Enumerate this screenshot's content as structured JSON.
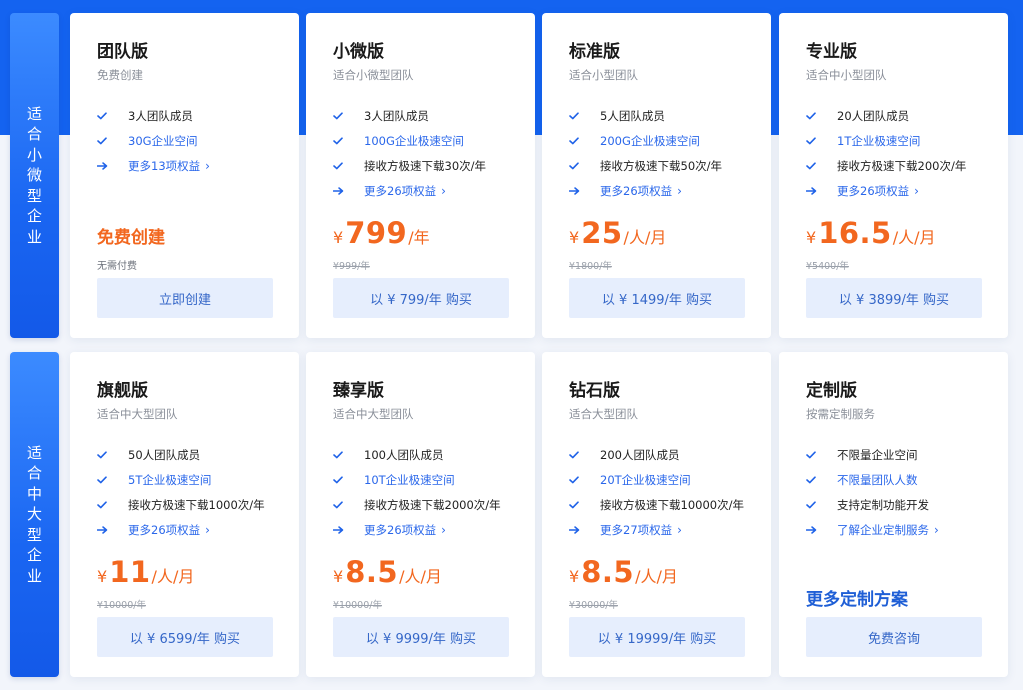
{
  "rows": [
    {
      "label": [
        "适",
        "合",
        "小",
        "微",
        "型",
        "企",
        "业"
      ],
      "cards": [
        {
          "title": "团队版",
          "subtitle": "免费创建",
          "features": [
            {
              "icon": "check-icon",
              "text": "3人团队成员",
              "blue": false
            },
            {
              "icon": "check-icon",
              "text": "30G企业空间",
              "blue": true
            },
            {
              "icon": "arrow-right-icon",
              "text": "更多13项权益",
              "more": true
            }
          ],
          "free_title": "免费创建",
          "free_note": "无需付费",
          "button": "立即创建"
        },
        {
          "title": "小微版",
          "subtitle": "适合小微型团队",
          "features": [
            {
              "icon": "check-icon",
              "text": "3人团队成员",
              "blue": false
            },
            {
              "icon": "check-icon",
              "text": "100G企业极速空间",
              "blue": true
            },
            {
              "icon": "check-icon",
              "text": "接收方极速下载30次/年",
              "blue": false
            },
            {
              "icon": "arrow-right-icon",
              "text": "更多26项权益",
              "more": true
            }
          ],
          "price": {
            "currency": "¥",
            "amount": "799",
            "unit": "/年"
          },
          "original": "¥999/年",
          "button": "以 ¥ 799/年 购买"
        },
        {
          "title": "标准版",
          "subtitle": "适合小型团队",
          "features": [
            {
              "icon": "check-icon",
              "text": "5人团队成员",
              "blue": false
            },
            {
              "icon": "check-icon",
              "text": "200G企业极速空间",
              "blue": true
            },
            {
              "icon": "check-icon",
              "text": "接收方极速下载50次/年",
              "blue": false
            },
            {
              "icon": "arrow-right-icon",
              "text": "更多26项权益",
              "more": true
            }
          ],
          "price": {
            "currency": "¥",
            "amount": "25",
            "unit": "/人/月"
          },
          "original": "¥1800/年",
          "button": "以 ¥ 1499/年 购买"
        },
        {
          "title": "专业版",
          "subtitle": "适合中小型团队",
          "features": [
            {
              "icon": "check-icon",
              "text": "20人团队成员",
              "blue": false
            },
            {
              "icon": "check-icon",
              "text": "1T企业极速空间",
              "blue": true
            },
            {
              "icon": "check-icon",
              "text": "接收方极速下载200次/年",
              "blue": false
            },
            {
              "icon": "arrow-right-icon",
              "text": "更多26项权益",
              "more": true
            }
          ],
          "price": {
            "currency": "¥",
            "amount": "16.5",
            "unit": "/人/月"
          },
          "original": "¥5400/年",
          "button": "以 ¥ 3899/年 购买"
        }
      ]
    },
    {
      "label": [
        "适",
        "合",
        "中",
        "大",
        "型",
        "企",
        "业"
      ],
      "cards": [
        {
          "title": "旗舰版",
          "subtitle": "适合中大型团队",
          "features": [
            {
              "icon": "check-icon",
              "text": "50人团队成员",
              "blue": false
            },
            {
              "icon": "check-icon",
              "text": "5T企业极速空间",
              "blue": true
            },
            {
              "icon": "check-icon",
              "text": "接收方极速下载1000次/年",
              "blue": false
            },
            {
              "icon": "arrow-right-icon",
              "text": "更多26项权益",
              "more": true
            }
          ],
          "price": {
            "currency": "¥",
            "amount": "11",
            "unit": "/人/月"
          },
          "original": "¥10000/年",
          "button": "以 ¥ 6599/年 购买"
        },
        {
          "title": "臻享版",
          "subtitle": "适合中大型团队",
          "features": [
            {
              "icon": "check-icon",
              "text": "100人团队成员",
              "blue": false
            },
            {
              "icon": "check-icon",
              "text": "10T企业极速空间",
              "blue": true
            },
            {
              "icon": "check-icon",
              "text": "接收方极速下载2000次/年",
              "blue": false
            },
            {
              "icon": "arrow-right-icon",
              "text": "更多26项权益",
              "more": true
            }
          ],
          "price": {
            "currency": "¥",
            "amount": "8.5",
            "unit": "/人/月"
          },
          "original": "¥10000/年",
          "button": "以 ¥ 9999/年 购买"
        },
        {
          "title": "钻石版",
          "subtitle": "适合大型团队",
          "features": [
            {
              "icon": "check-icon",
              "text": "200人团队成员",
              "blue": false
            },
            {
              "icon": "check-icon",
              "text": "20T企业极速空间",
              "blue": true
            },
            {
              "icon": "check-icon",
              "text": "接收方极速下载10000次/年",
              "blue": false
            },
            {
              "icon": "arrow-right-icon",
              "text": "更多27项权益",
              "more": true
            }
          ],
          "price": {
            "currency": "¥",
            "amount": "8.5",
            "unit": "/人/月"
          },
          "original": "¥30000/年",
          "button": "以 ¥ 19999/年 购买"
        },
        {
          "title": "定制版",
          "subtitle": "按需定制服务",
          "features": [
            {
              "icon": "check-icon",
              "text": "不限量企业空间",
              "blue": false
            },
            {
              "icon": "check-icon",
              "text": "不限量团队人数",
              "blue": true
            },
            {
              "icon": "check-icon",
              "text": "支持定制功能开发",
              "blue": false
            },
            {
              "icon": "arrow-right-icon",
              "text": "了解企业定制服务",
              "more": true
            }
          ],
          "custom_title": "更多定制方案",
          "button": "免费咨询"
        }
      ]
    }
  ],
  "colors": {
    "accent": "#1463f0",
    "price": "#f2671f",
    "button_bg": "#e6eefd"
  }
}
